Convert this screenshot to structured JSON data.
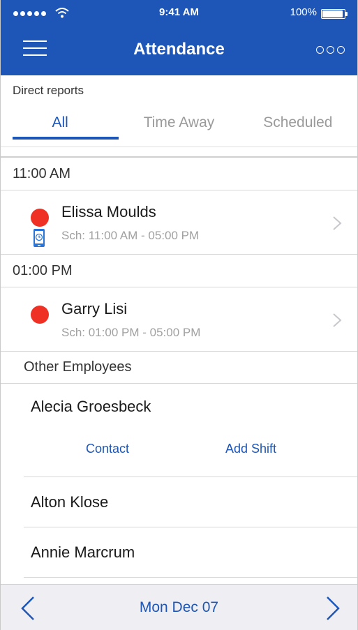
{
  "status_bar": {
    "time": "9:41 AM",
    "battery_percent": "100%",
    "battery_level": 1.0
  },
  "nav": {
    "title": "Attendance",
    "menu_icon": "hamburger-icon",
    "more_icon": "more-options-icon"
  },
  "filter": {
    "label": "Direct reports",
    "tabs": [
      {
        "label": "All",
        "active": true
      },
      {
        "label": "Time Away",
        "active": false
      },
      {
        "label": "Scheduled",
        "active": false
      }
    ]
  },
  "schedule_groups": [
    {
      "time": "11:00 AM",
      "employees": [
        {
          "name": "Elissa Moulds",
          "schedule": "Sch: 11:00 AM - 05:00 PM",
          "status_color": "#ee3124",
          "has_phone_clock": true
        }
      ]
    },
    {
      "time": "01:00 PM",
      "employees": [
        {
          "name": "Garry Lisi",
          "schedule": "Sch: 01:00 PM - 05:00 PM",
          "status_color": "#ee3124",
          "has_phone_clock": false
        }
      ]
    }
  ],
  "other_employees": {
    "header": "Other Employees",
    "items": [
      {
        "name": "Alecia Groesbeck",
        "contact_label": "Contact",
        "add_shift_label": "Add Shift"
      },
      {
        "name": "Alton Klose"
      },
      {
        "name": "Annie Marcrum"
      }
    ]
  },
  "bottom_bar": {
    "date": "Mon Dec 07"
  },
  "colors": {
    "brand": "#1d56b6",
    "status_absent": "#ee3124"
  }
}
